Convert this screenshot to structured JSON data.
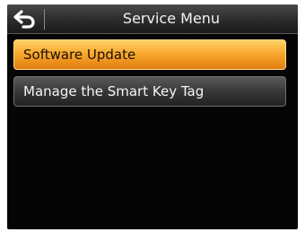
{
  "header": {
    "title": "Service Menu",
    "back_icon": "back-arrow-icon"
  },
  "menu": {
    "items": [
      {
        "label": "Software Update",
        "selected": true
      },
      {
        "label": "Manage the Smart Key Tag",
        "selected": false
      }
    ]
  },
  "colors": {
    "background": "#050505",
    "selected_accent": "#f7a52a",
    "text": "#f5f5f5"
  }
}
